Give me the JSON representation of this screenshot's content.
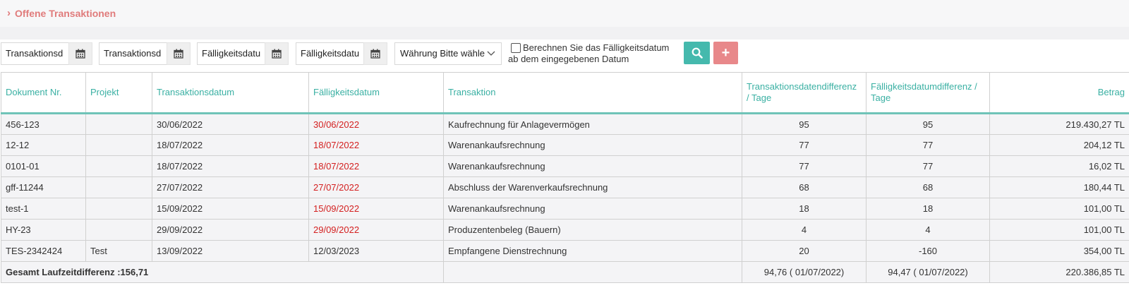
{
  "header": {
    "title": "Offene Transaktionen",
    "chevron_icon": "chevron-right-icon"
  },
  "filters": {
    "date1_placeholder": "Transaktionsd",
    "date2_placeholder": "Transaktionsd",
    "date3_placeholder": "Fälligkeitsdatu",
    "date4_placeholder": "Fälligkeitsdatu",
    "currency_selected": "Währung Bitte wähle",
    "checkbox_label_line1": "Berechnen Sie das Fälligkeitsdatum",
    "checkbox_label_line2": "ab dem eingegebenen Datum",
    "checkbox_checked": false,
    "search_icon": "search-icon",
    "add_label": "+"
  },
  "table": {
    "columns": [
      "Dokument Nr.",
      "Projekt",
      "Transaktionsdatum",
      "Fälligkeitsdatum",
      "Transaktion",
      "Transaktionsdatendifferenz / Tage",
      "Fälligkeitsdatumdifferenz / Tage",
      "Betrag"
    ],
    "rows": [
      {
        "doc": "456-123",
        "project": "",
        "tdate": "30/06/2022",
        "ddate": "30/06/2022",
        "overdue": true,
        "transaction": "Kaufrechnung für Anlagevermögen",
        "tdiff": "95",
        "ddiff": "95",
        "amount": "219.430,27 TL"
      },
      {
        "doc": "12-12",
        "project": "",
        "tdate": "18/07/2022",
        "ddate": "18/07/2022",
        "overdue": true,
        "transaction": "Warenankaufsrechnung",
        "tdiff": "77",
        "ddiff": "77",
        "amount": "204,12 TL"
      },
      {
        "doc": "0101-01",
        "project": "",
        "tdate": "18/07/2022",
        "ddate": "18/07/2022",
        "overdue": true,
        "transaction": "Warenankaufsrechnung",
        "tdiff": "77",
        "ddiff": "77",
        "amount": "16,02 TL"
      },
      {
        "doc": "gff-11244",
        "project": "",
        "tdate": "27/07/2022",
        "ddate": "27/07/2022",
        "overdue": true,
        "transaction": "Abschluss der Warenverkaufsrechnung",
        "tdiff": "68",
        "ddiff": "68",
        "amount": "180,44 TL"
      },
      {
        "doc": "test-1",
        "project": "",
        "tdate": "15/09/2022",
        "ddate": "15/09/2022",
        "overdue": true,
        "transaction": "Warenankaufsrechnung",
        "tdiff": "18",
        "ddiff": "18",
        "amount": "101,00 TL"
      },
      {
        "doc": "HY-23",
        "project": "",
        "tdate": "29/09/2022",
        "ddate": "29/09/2022",
        "overdue": true,
        "transaction": "Produzentenbeleg (Bauern)",
        "tdiff": "4",
        "ddiff": "4",
        "amount": "101,00 TL"
      },
      {
        "doc": "TES-2342424",
        "project": "Test",
        "tdate": "13/09/2022",
        "ddate": "12/03/2023",
        "overdue": false,
        "transaction": "Empfangene Dienstrechnung",
        "tdiff": "20",
        "ddiff": "-160",
        "amount": "354,00 TL"
      }
    ],
    "total": {
      "label": "Gesamt Laufzeitdifferenz :156,71",
      "tdiff": "94,76 ( 01/07/2022)",
      "ddiff": "94,47 ( 01/07/2022)",
      "amount": "220.386,85 TL"
    }
  },
  "colors": {
    "accent_teal": "#45b9ad",
    "accent_red": "#e07b7b",
    "overdue_red": "#d42020"
  }
}
